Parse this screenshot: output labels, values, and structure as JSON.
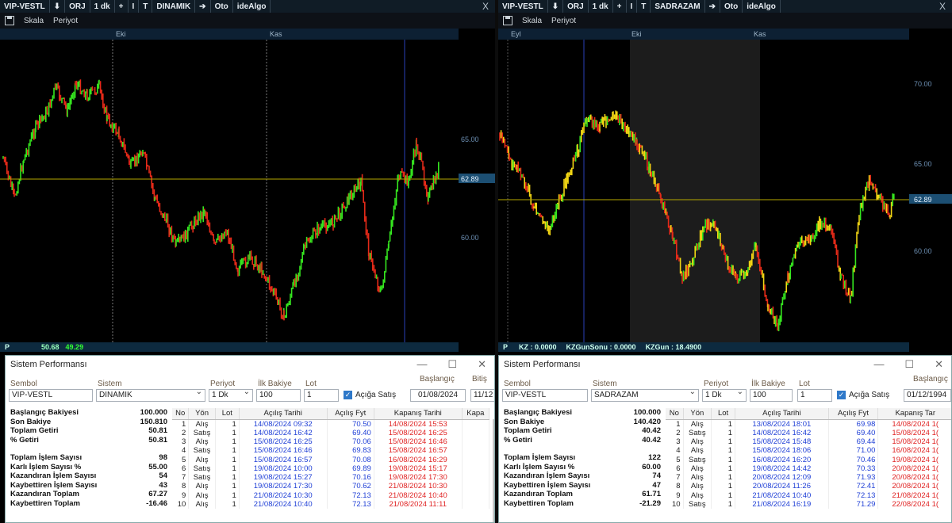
{
  "colors": {
    "up": "#35e51f",
    "down": "#e52a19",
    "yellow": "#f1d514",
    "hline": "#b6a800",
    "accent": "#1d82c9"
  },
  "left": {
    "title": {
      "symbol": "VIP-VESTL",
      "down_icon": "⬇",
      "mode": "ORJ",
      "period": "1 dk",
      "plus": "+",
      "sep": "I",
      "t": "T",
      "system": "DINAMIK",
      "arrow": "➔",
      "auto": "Oto",
      "brand": "ideAlgo",
      "close": "X"
    },
    "toolbar": {
      "scale": "Skala",
      "period": "Periyot"
    },
    "dates": [
      "Eki",
      "Kas"
    ],
    "price_axis": {
      "ticks": [
        "65.00",
        "62.89",
        "60.00"
      ]
    },
    "status": {
      "p": "P",
      "v1": "50.68",
      "v2": "49.29"
    },
    "perf": {
      "title": "Sistem Performansı",
      "labels": {
        "symbol": "Sembol",
        "system": "Sistem",
        "period": "Periyot",
        "balance": "İlk Bakiye",
        "lot": "Lot",
        "start": "Başlangıç",
        "end": "Bitiş",
        "short": "Açığa Satış"
      },
      "values": {
        "symbol": "VIP-VESTL",
        "system": "DINAMIK",
        "period": "1 Dk",
        "balance": "100",
        "lot": "1",
        "start": "01/08/2024",
        "end": "11/12"
      },
      "stats": [
        [
          "Başlangıç Bakiyesi",
          "100.000"
        ],
        [
          "Son Bakiye",
          "150.810"
        ],
        [
          "Toplam Getiri",
          "50.81"
        ],
        [
          "% Getiri",
          "50.81"
        ],
        [
          "Toplam İşlem Sayısı",
          "98"
        ],
        [
          "Karlı İşlem Sayısı %",
          "55.00"
        ],
        [
          "Kazandıran İşlem Sayısı",
          "54"
        ],
        [
          "Kaybettiren İşlem Sayısı",
          "43"
        ],
        [
          "Kazandıran Toplam",
          "67.27"
        ],
        [
          "Kaybettiren Toplam",
          "-16.46"
        ]
      ],
      "columns": [
        "No",
        "Yön",
        "Lot",
        "Açılış Tarihi",
        "Açılış Fyt",
        "Kapanış Tarihi",
        "Kapa"
      ],
      "rows": [
        [
          "1",
          "Alış",
          "1",
          "14/08/2024 09:32",
          "70.50",
          "14/08/2024 15:53"
        ],
        [
          "2",
          "Satış",
          "1",
          "14/08/2024 16:42",
          "69.40",
          "15/08/2024 16:25"
        ],
        [
          "3",
          "Alış",
          "1",
          "15/08/2024 16:25",
          "70.06",
          "15/08/2024 16:46"
        ],
        [
          "4",
          "Satış",
          "1",
          "15/08/2024 16:46",
          "69.83",
          "15/08/2024 16:57"
        ],
        [
          "5",
          "Alış",
          "1",
          "15/08/2024 16:57",
          "70.08",
          "16/08/2024 16:29"
        ],
        [
          "6",
          "Satış",
          "1",
          "19/08/2024 10:00",
          "69.89",
          "19/08/2024 15:17"
        ],
        [
          "7",
          "Satış",
          "1",
          "19/08/2024 15:27",
          "70.16",
          "19/08/2024 17:30"
        ],
        [
          "8",
          "Alış",
          "1",
          "19/08/2024 17:30",
          "70.62",
          "21/08/2024 10:30"
        ],
        [
          "9",
          "Alış",
          "1",
          "21/08/2024 10:30",
          "72.13",
          "21/08/2024 10:40"
        ],
        [
          "10",
          "Alış",
          "1",
          "21/08/2024 10:40",
          "72.13",
          "21/08/2024 11:11"
        ]
      ]
    }
  },
  "right": {
    "title": {
      "symbol": "VIP-VESTL",
      "down_icon": "⬇",
      "mode": "ORJ",
      "period": "1 dk",
      "plus": "+",
      "sep": "I",
      "t": "T",
      "system": "SADRAZAM",
      "arrow": "➔",
      "auto": "Oto",
      "brand": "ideAlgo",
      "close": "X"
    },
    "toolbar": {
      "scale": "Skala",
      "period": "Periyot"
    },
    "dates": [
      "Eyl",
      "Eki",
      "Kas"
    ],
    "price_axis": {
      "ticks": [
        "70.00",
        "65.00",
        "62.89",
        "60.00"
      ]
    },
    "status": {
      "p": "P",
      "kz": "KZ : 0.0000",
      "kzgs": "KZGunSonu : 0.0000",
      "kzg": "KZGun : 18.4900"
    },
    "perf": {
      "title": "Sistem Performansı",
      "labels": {
        "symbol": "Sembol",
        "system": "Sistem",
        "period": "Periyot",
        "balance": "İlk Bakiye",
        "lot": "Lot",
        "start": "Başlangıç",
        "short": "Açığa Satış"
      },
      "values": {
        "symbol": "VIP-VESTL",
        "system": "SADRAZAM",
        "period": "1 Dk",
        "balance": "100",
        "lot": "1",
        "start": "01/12/1994"
      },
      "stats": [
        [
          "Başlangıç Bakiyesi",
          "100.000"
        ],
        [
          "Son Bakiye",
          "140.420"
        ],
        [
          "Toplam Getiri",
          "40.42"
        ],
        [
          "% Getiri",
          "40.42"
        ],
        [
          "Toplam İşlem Sayısı",
          "122"
        ],
        [
          "Karlı İşlem Sayısı %",
          "60.00"
        ],
        [
          "Kazandıran İşlem Sayısı",
          "74"
        ],
        [
          "Kaybettiren İşlem Sayısı",
          "47"
        ],
        [
          "Kazandıran Toplam",
          "61.71"
        ],
        [
          "Kaybettiren Toplam",
          "-21.29"
        ]
      ],
      "columns": [
        "No",
        "Yön",
        "Lot",
        "Açılış Tarihi",
        "Açılış Fyt",
        "Kapanış Tar"
      ],
      "rows": [
        [
          "1",
          "Alış",
          "1",
          "13/08/2024 18:01",
          "69.98",
          "14/08/2024 1("
        ],
        [
          "2",
          "Satış",
          "1",
          "14/08/2024 16:42",
          "69.40",
          "15/08/2024 1("
        ],
        [
          "3",
          "Alış",
          "1",
          "15/08/2024 15:48",
          "69.44",
          "15/08/2024 1("
        ],
        [
          "4",
          "Alış",
          "1",
          "15/08/2024 18:06",
          "71.00",
          "16/08/2024 1("
        ],
        [
          "5",
          "Satış",
          "1",
          "16/08/2024 16:20",
          "70.46",
          "19/08/2024 1("
        ],
        [
          "6",
          "Alış",
          "1",
          "19/08/2024 14:42",
          "70.33",
          "20/08/2024 1("
        ],
        [
          "7",
          "Alış",
          "1",
          "20/08/2024 12:09",
          "71.93",
          "20/08/2024 1("
        ],
        [
          "8",
          "Alış",
          "1",
          "20/08/2024 11:26",
          "72.41",
          "20/08/2024 1("
        ],
        [
          "9",
          "Alış",
          "1",
          "21/08/2024 10:40",
          "72.13",
          "21/08/2024 1("
        ],
        [
          "10",
          "Satış",
          "1",
          "21/08/2024 16:19",
          "71.29",
          "22/08/2024 1("
        ]
      ]
    }
  }
}
